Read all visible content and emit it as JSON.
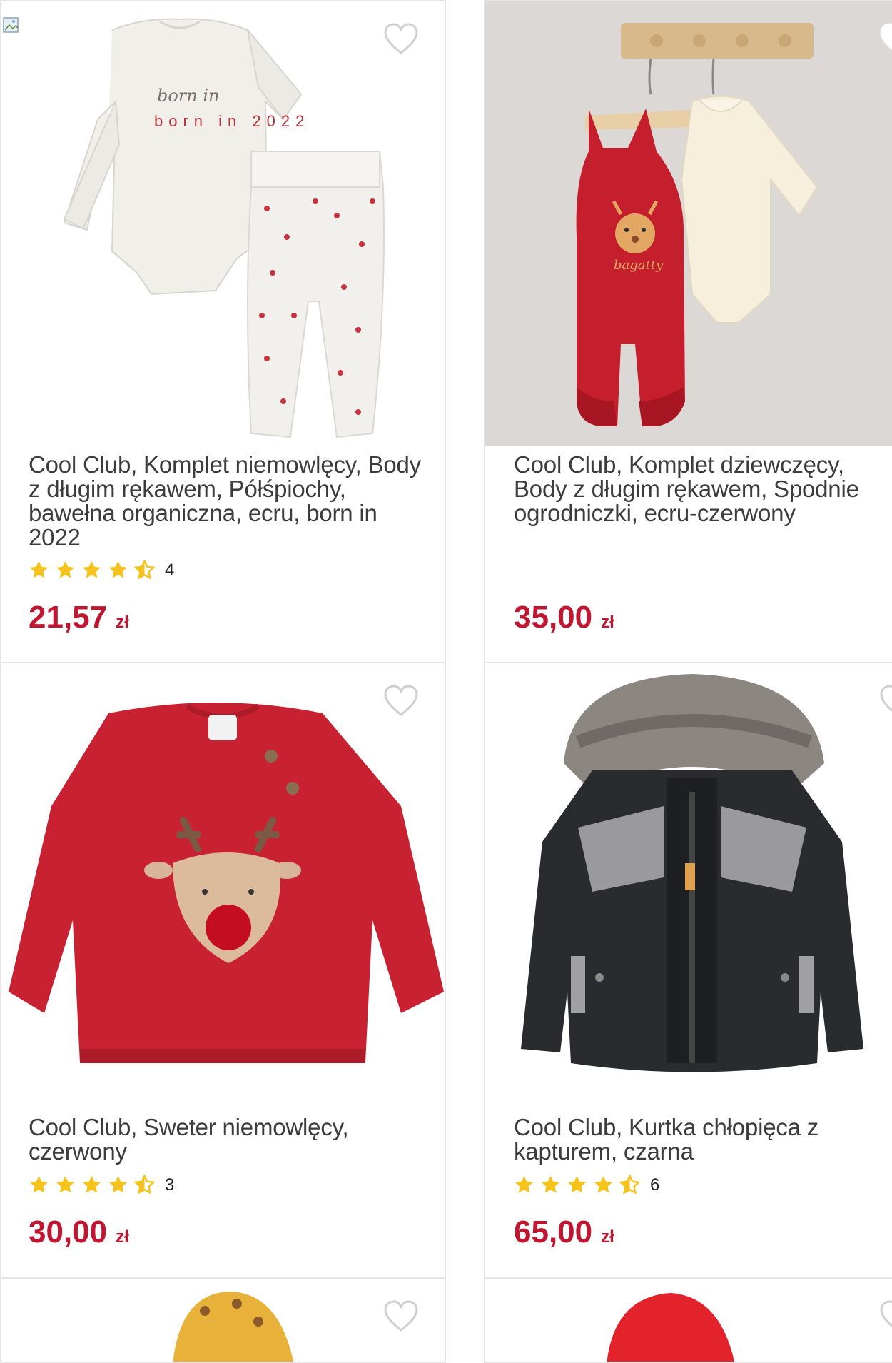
{
  "products": [
    {
      "title": "Cool Club, Komplet niemowlęcy, Body z długim rękawem, Półśpiochy, bawełna organiczna, ecru, born in 2022",
      "rating": 4.5,
      "rating_count": "4",
      "price": "21,57",
      "currency": "zł",
      "image_label": "born in 2022",
      "favorite": false
    },
    {
      "title": "Cool Club, Komplet dziewczęcy, Body z długim rękawem, Spodnie ogrodniczki, ecru-czerwony",
      "rating": null,
      "rating_count": "",
      "price": "35,00",
      "currency": "zł",
      "favorite": false
    },
    {
      "title": "Cool Club, Sweter niemowlęcy, czerwony",
      "rating": 4.5,
      "rating_count": "3",
      "price": "30,00",
      "currency": "zł",
      "favorite": false
    },
    {
      "title": "Cool Club, Kurtka chłopięca z kapturem, czarna",
      "rating": 4.5,
      "rating_count": "6",
      "price": "65,00",
      "currency": "zł",
      "favorite": false
    },
    {
      "title": "",
      "rating": null,
      "rating_count": "",
      "price": "",
      "currency": "",
      "favorite": false
    },
    {
      "title": "",
      "rating": null,
      "rating_count": "",
      "price": "",
      "currency": "",
      "favorite": false
    }
  ],
  "colors": {
    "price": "#bf1731",
    "star": "#f6c21c",
    "border": "#e5e5e5",
    "heart": "#cfcfcf"
  }
}
